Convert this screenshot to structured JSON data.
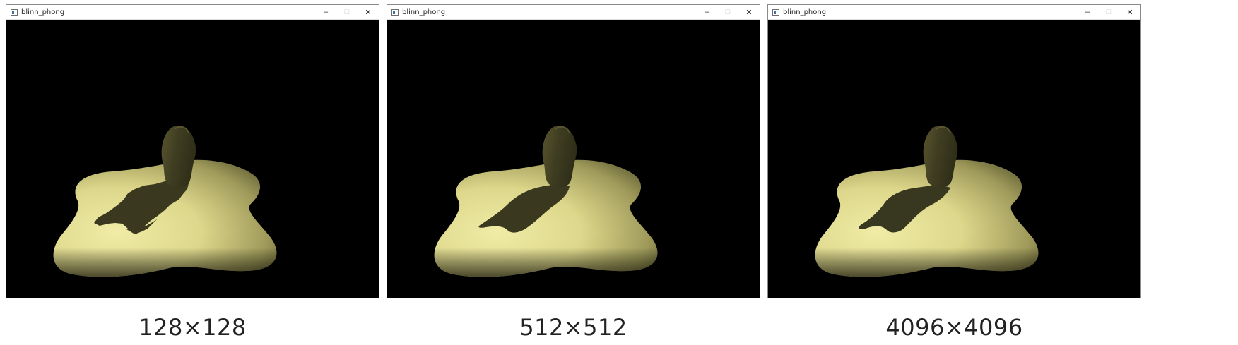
{
  "windows": [
    {
      "title": "blinn_phong",
      "caption": "128×128",
      "controls": {
        "minimize": "–",
        "maximize": "□",
        "close": "✕"
      }
    },
    {
      "title": "blinn_phong",
      "caption": "512×512",
      "controls": {
        "minimize": "–",
        "maximize": "□",
        "close": "✕"
      }
    },
    {
      "title": "blinn_phong",
      "caption": "4096×4096",
      "controls": {
        "minimize": "–",
        "maximize": "□",
        "close": "✕"
      }
    }
  ],
  "colors": {
    "surface_light": "#e8e49a",
    "surface_dark": "#3b3a1e",
    "shadow": "#3a3a20",
    "background": "#000000"
  }
}
